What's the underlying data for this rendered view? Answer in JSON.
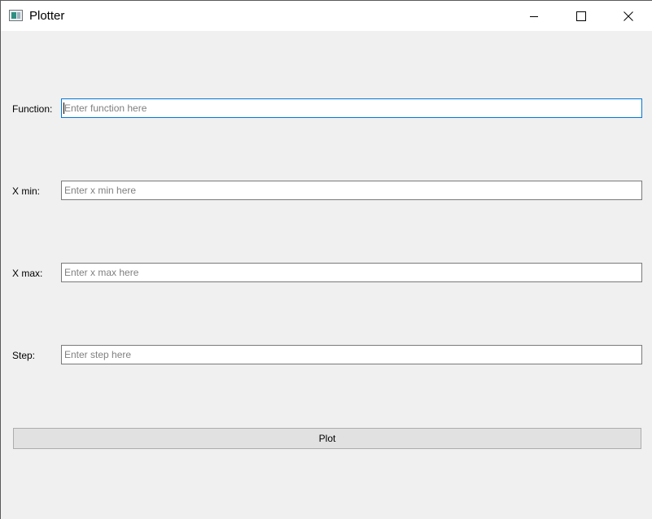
{
  "window": {
    "title": "Plotter",
    "icon": "application-window-icon",
    "controls": {
      "minimize": "minimize-icon",
      "maximize": "maximize-icon",
      "close": "close-icon"
    }
  },
  "form": {
    "function": {
      "label": "Function:",
      "value": "",
      "placeholder": "Enter function here",
      "focused": true
    },
    "x_min": {
      "label": "X min:",
      "value": "",
      "placeholder": "Enter x min here"
    },
    "x_max": {
      "label": "X max:",
      "value": "",
      "placeholder": "Enter x max here"
    },
    "step": {
      "label": "Step:",
      "value": "",
      "placeholder": "Enter step here"
    }
  },
  "actions": {
    "plot_label": "Plot"
  },
  "colors": {
    "window_bg": "#f0f0f0",
    "titlebar_bg": "#ffffff",
    "focus_border": "#0078d7",
    "input_border": "#7a7a7a",
    "button_bg": "#e1e1e1",
    "button_border": "#adadad"
  }
}
